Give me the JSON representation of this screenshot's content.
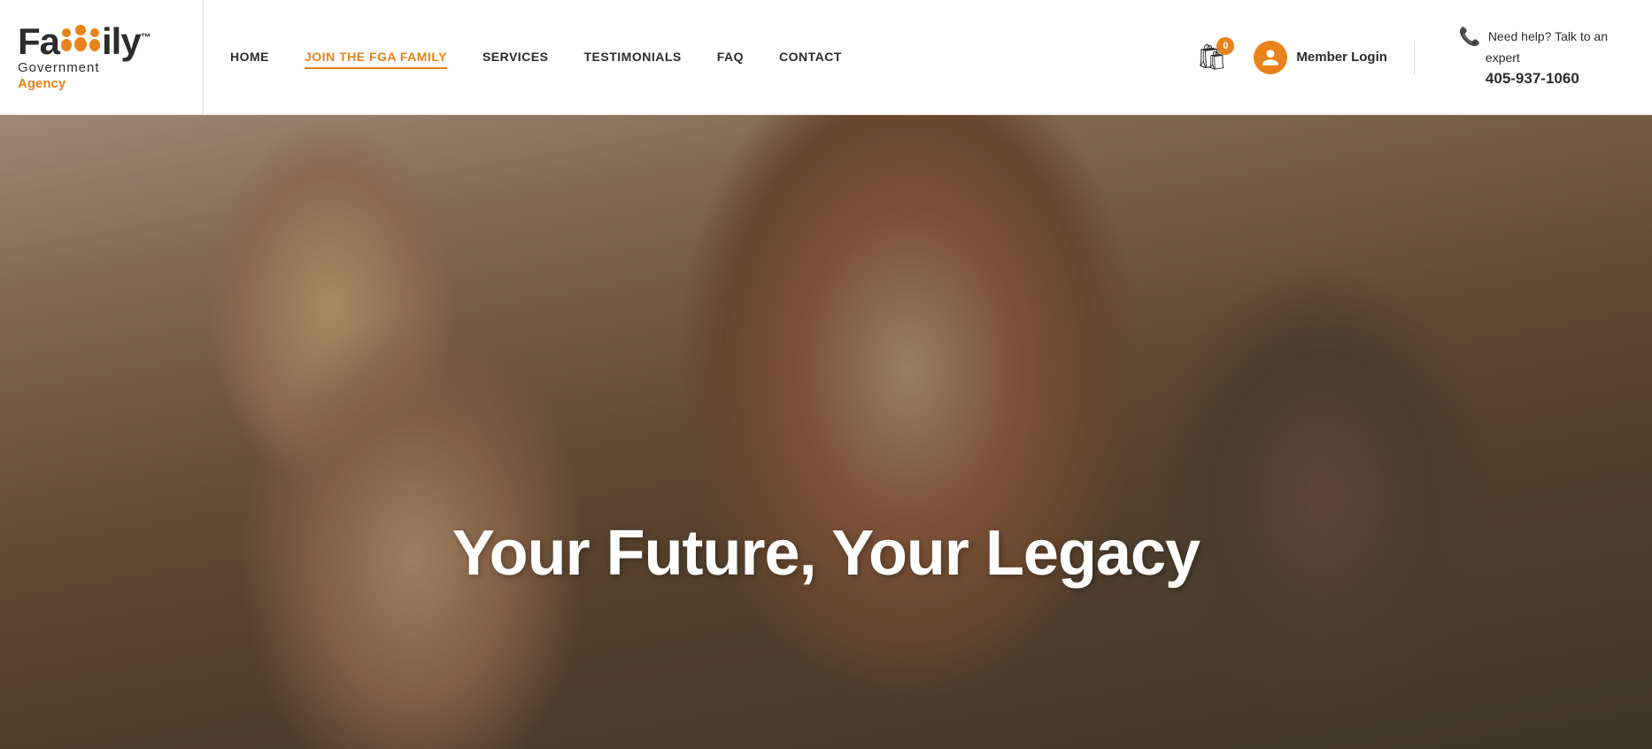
{
  "logo": {
    "name_part1": "Fa",
    "name_part2": "ily",
    "tm": "™",
    "sub1": "Government",
    "sub2": "Agency",
    "tagline": "Your Future, Your Legacy"
  },
  "nav": {
    "items": [
      {
        "label": "HOME",
        "active": false
      },
      {
        "label": "JOIN THE FGA FAMILY",
        "active": true
      },
      {
        "label": "SERVICES",
        "active": false
      },
      {
        "label": "TESTIMONIALS",
        "active": false
      },
      {
        "label": "FAQ",
        "active": false
      },
      {
        "label": "CONTACT",
        "active": false
      }
    ]
  },
  "cart": {
    "badge": "0"
  },
  "member_login": {
    "label": "Member Login"
  },
  "help": {
    "line1": "Need help? Talk to an",
    "line2": "expert",
    "phone": "405-937-1060"
  },
  "hero": {
    "title": "Your Future, Your Legacy"
  }
}
